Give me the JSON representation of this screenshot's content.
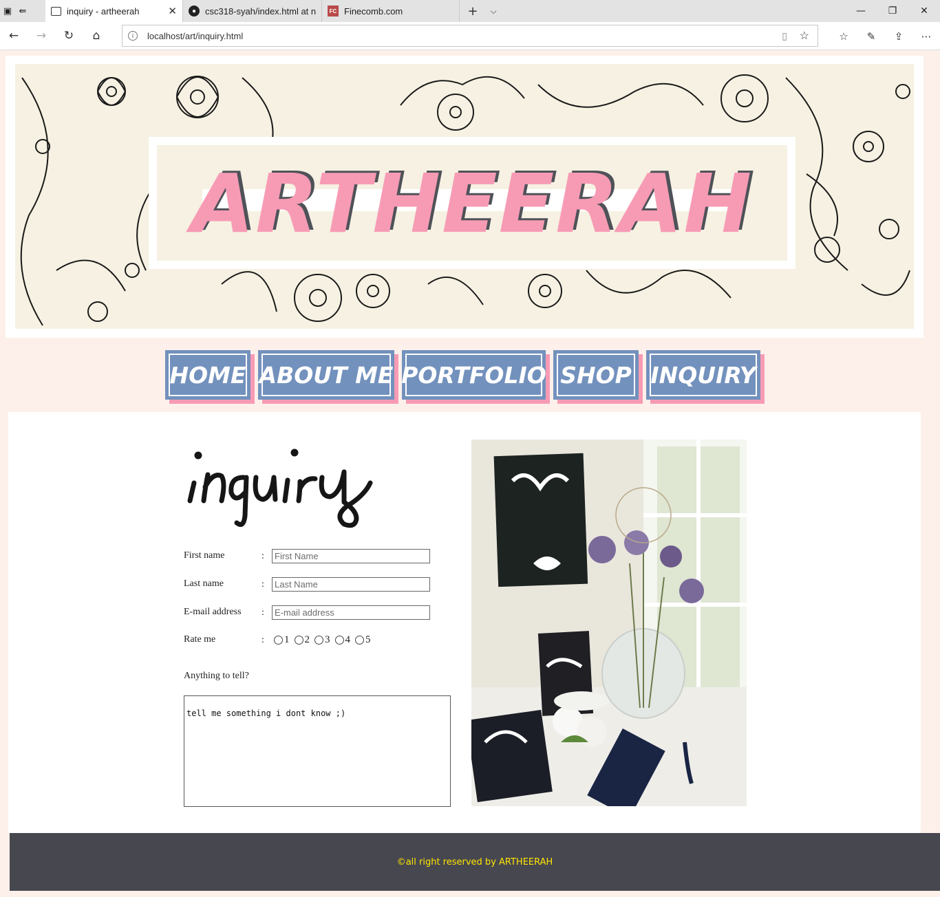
{
  "browser": {
    "tabs": [
      {
        "title": "inquiry - artheerah",
        "active": true
      },
      {
        "title": "csc318-syah/index.html at n",
        "active": false
      },
      {
        "title": "Finecomb.com",
        "active": false
      }
    ],
    "fc_favicon": "FC",
    "url": "localhost/art/inquiry.html"
  },
  "site": {
    "brand": "ARTHEERAH",
    "nav": [
      "HOME",
      "ABOUT ME",
      "PORTFOLIO",
      "SHOP",
      "INQUIRY"
    ],
    "heading": "inquiry"
  },
  "form": {
    "first_name_label": "First name",
    "first_name_placeholder": "First Name",
    "last_name_label": "Last name",
    "last_name_placeholder": "Last Name",
    "email_label": "E-mail address",
    "email_placeholder": "E-mail address",
    "rate_label": "Rate me",
    "rating_options": [
      "1",
      "2",
      "3",
      "4",
      "5"
    ],
    "colon": ":",
    "message_label": "Anything to tell?",
    "message_value": "tell me something i dont know ;)"
  },
  "footer": {
    "text": "©all right reserved by ARTHEERAH"
  },
  "colors": {
    "page_bg": "#fdf0ea",
    "nav_blue": "#7391bd",
    "accent_pink": "#f79bb5",
    "logo_shadow": "#4f5258",
    "footer_bg": "#474750",
    "footer_text": "#ffe600",
    "banner_cream": "#f6f1e2"
  }
}
